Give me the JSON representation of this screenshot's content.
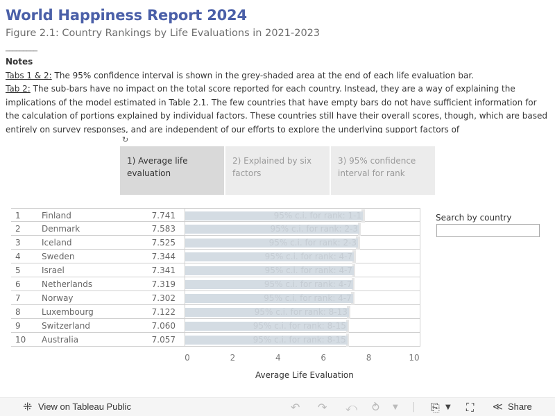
{
  "header": {
    "title": "World Happiness Report 2024",
    "subtitle": "Figure 2.1: Country Rankings by Life Evaluations in 2021-2023",
    "separator": "_________"
  },
  "notes": {
    "heading": "Notes",
    "tab12_label": "Tabs 1 & 2:",
    "tab12_text": " The 95% confidence interval is shown in the grey-shaded area at the end of each life evaluation bar.",
    "tab2_label": "Tab 2:",
    "tab2_text": " The sub-bars have no impact on the total score reported for each country. Instead, they are a way of explaining the implications of the model estimated in Table 2.1. The few countries that have empty bars do not have sufficient information for the calculation of portions explained by individual factors. These countries still have their overall scores, though, which are based entirely on survey responses, and are independent of our efforts to explore the underlying support factors of"
  },
  "tabs": [
    {
      "label": "1) Average life evaluation",
      "active": true
    },
    {
      "label": "2) Explained by six factors",
      "active": false
    },
    {
      "label": "3) 95% confidence interval for rank",
      "active": false
    }
  ],
  "search": {
    "label": "Search by country",
    "value": "",
    "placeholder": ""
  },
  "chart_data": {
    "type": "bar",
    "orientation": "horizontal",
    "xlabel": "Average Life Evaluation",
    "xlim": [
      0,
      10
    ],
    "xticks": [
      "0",
      "2",
      "4",
      "6",
      "8",
      "10"
    ],
    "ci_label_prefix": "95% c.i. for rank: ",
    "rows": [
      {
        "rank": "1",
        "country": "Finland",
        "score": "7.741",
        "value": 7.741,
        "ci_rank": "1-1",
        "ci_low": 7.67,
        "ci_high": 7.82
      },
      {
        "rank": "2",
        "country": "Denmark",
        "score": "7.583",
        "value": 7.583,
        "ci_rank": "2-3",
        "ci_low": 7.51,
        "ci_high": 7.66
      },
      {
        "rank": "3",
        "country": "Iceland",
        "score": "7.525",
        "value": 7.525,
        "ci_rank": "2-3",
        "ci_low": 7.42,
        "ci_high": 7.63
      },
      {
        "rank": "4",
        "country": "Sweden",
        "score": "7.344",
        "value": 7.344,
        "ci_rank": "4-7",
        "ci_low": 7.27,
        "ci_high": 7.42
      },
      {
        "rank": "5",
        "country": "Israel",
        "score": "7.341",
        "value": 7.341,
        "ci_rank": "4-7",
        "ci_low": 7.27,
        "ci_high": 7.41
      },
      {
        "rank": "6",
        "country": "Netherlands",
        "score": "7.319",
        "value": 7.319,
        "ci_rank": "4-7",
        "ci_low": 7.26,
        "ci_high": 7.38
      },
      {
        "rank": "7",
        "country": "Norway",
        "score": "7.302",
        "value": 7.302,
        "ci_rank": "4-7",
        "ci_low": 7.23,
        "ci_high": 7.38
      },
      {
        "rank": "8",
        "country": "Luxembourg",
        "score": "7.122",
        "value": 7.122,
        "ci_rank": "8-13",
        "ci_low": 7.04,
        "ci_high": 7.2
      },
      {
        "rank": "9",
        "country": "Switzerland",
        "score": "7.060",
        "value": 7.06,
        "ci_rank": "8-15",
        "ci_low": 6.99,
        "ci_high": 7.13
      },
      {
        "rank": "10",
        "country": "Australia",
        "score": "7.057",
        "value": 7.057,
        "ci_rank": "8-15",
        "ci_low": 6.99,
        "ci_high": 7.12
      }
    ]
  },
  "footer": {
    "view_label": "View on Tableau Public",
    "share_label": "Share",
    "icons": [
      "tableau-logo-icon",
      "undo-icon",
      "redo-icon",
      "revert-icon",
      "refresh-icon",
      "download-icon",
      "fullscreen-icon",
      "share-icon"
    ]
  },
  "colors": {
    "title": "#4a5fa8",
    "bar": "#d4dce3",
    "ci": "#e6e6e6",
    "active_tab": "#d9d9d9",
    "inactive_tab": "#ececec"
  }
}
